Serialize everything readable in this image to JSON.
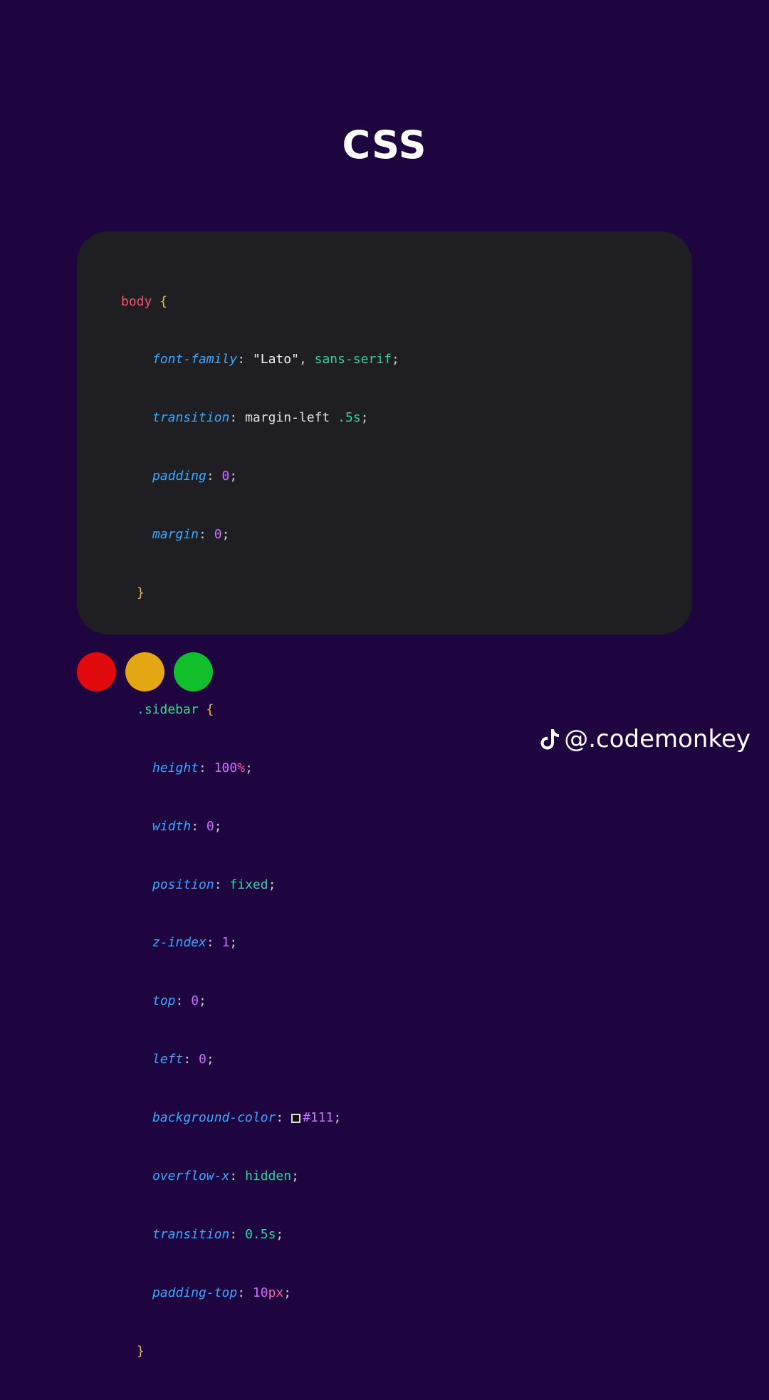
{
  "title": "CSS",
  "colors": {
    "background": "#1f0540",
    "panel": "#1f1f23",
    "red": "#e00a0f",
    "yellow": "#e2a713",
    "green": "#11bf2d"
  },
  "window_controls": {
    "icons": [
      "red-circle",
      "yellow-circle",
      "green-circle"
    ]
  },
  "code": {
    "body_selector": "body",
    "open_brace": "{",
    "close_brace": "}",
    "colon": ":",
    "semicolon": ";",
    "comma": ",",
    "body_rules": {
      "font_family_prop": "font-family",
      "font_family_str": "\"Lato\"",
      "font_family_kw": "sans-serif",
      "transition_prop": "transition",
      "transition_val": "margin-left",
      "transition_num": ".5",
      "transition_unit": "s",
      "padding_prop": "padding",
      "padding_num": "0",
      "margin_prop": "margin",
      "margin_num": "0"
    },
    "sidebar_selector": ".sidebar",
    "sidebar_rules": {
      "height_prop": "height",
      "height_num": "100",
      "height_unit": "%",
      "width_prop": "width",
      "width_num": "0",
      "position_prop": "position",
      "position_kw": "fixed",
      "zindex_prop": "z-index",
      "zindex_num": "1",
      "top_prop": "top",
      "top_num": "0",
      "left_prop": "left",
      "left_num": "0",
      "bg_prop": "background-color",
      "bg_val": "#111",
      "overflow_prop": "overflow-x",
      "overflow_kw": "hidden",
      "transition_prop": "transition",
      "transition_num": "0.5",
      "transition_unit": "s",
      "padtop_prop": "padding-top",
      "padtop_num": "10",
      "padtop_unit": "px"
    }
  },
  "handle": {
    "icon": "tiktok-icon",
    "text": "@.codemonkey"
  }
}
